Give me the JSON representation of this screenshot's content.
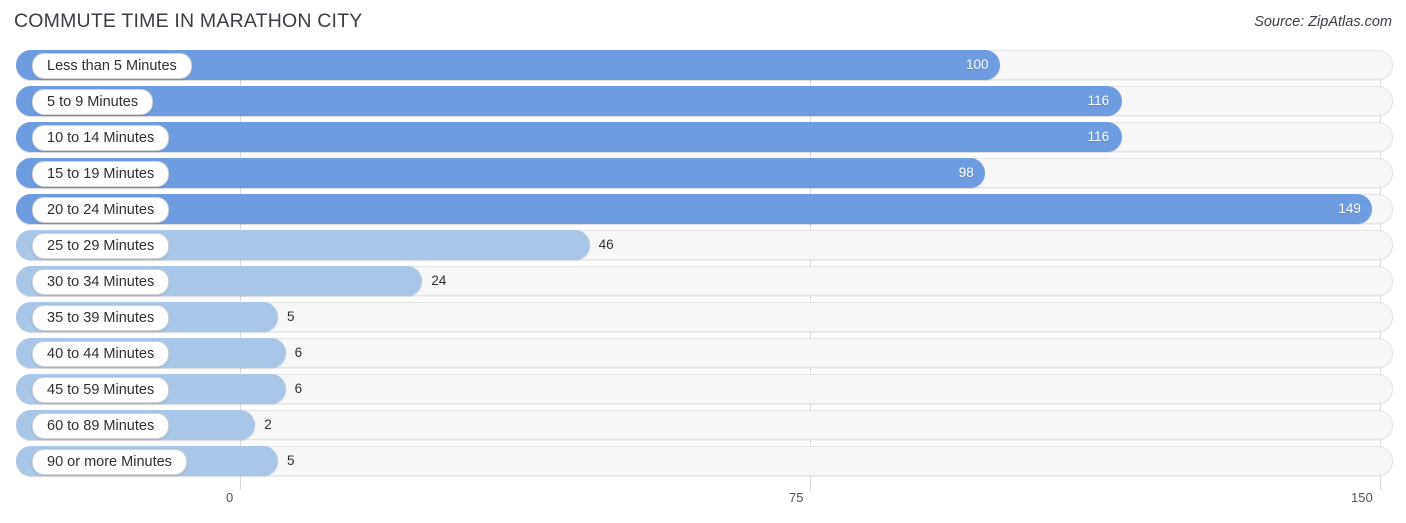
{
  "header": {
    "title": "COMMUTE TIME IN MARATHON CITY",
    "source": "Source: ZipAtlas.com"
  },
  "colors": {
    "bar_strong": "#6d9de0",
    "bar_light": "#a8c6e8",
    "track": "#f7f7f7",
    "track_border": "#e3e3e6",
    "grid": "#d9d9dd",
    "text": "#2f2f35"
  },
  "axis": {
    "ticks": [
      "0",
      "75",
      "150"
    ],
    "min": 0,
    "max": 150
  },
  "chart_data": {
    "type": "bar",
    "orientation": "horizontal",
    "title": "COMMUTE TIME IN MARATHON CITY",
    "source": "Source: ZipAtlas.com",
    "xlabel": "",
    "ylabel": "",
    "xlim": [
      0,
      150
    ],
    "xticks": [
      0,
      75,
      150
    ],
    "grid": true,
    "legend": "none",
    "categories": [
      "Less than 5 Minutes",
      "5 to 9 Minutes",
      "10 to 14 Minutes",
      "15 to 19 Minutes",
      "20 to 24 Minutes",
      "25 to 29 Minutes",
      "30 to 34 Minutes",
      "35 to 39 Minutes",
      "40 to 44 Minutes",
      "45 to 59 Minutes",
      "60 to 89 Minutes",
      "90 or more Minutes"
    ],
    "values": [
      100,
      116,
      116,
      98,
      149,
      46,
      24,
      5,
      6,
      6,
      2,
      5
    ]
  },
  "rows": [
    {
      "label": "Less than 5 Minutes",
      "value": "100",
      "num": 100,
      "inside": true
    },
    {
      "label": "5 to 9 Minutes",
      "value": "116",
      "num": 116,
      "inside": true
    },
    {
      "label": "10 to 14 Minutes",
      "value": "116",
      "num": 116,
      "inside": true
    },
    {
      "label": "15 to 19 Minutes",
      "value": "98",
      "num": 98,
      "inside": true
    },
    {
      "label": "20 to 24 Minutes",
      "value": "149",
      "num": 149,
      "inside": true
    },
    {
      "label": "25 to 29 Minutes",
      "value": "46",
      "num": 46,
      "inside": false
    },
    {
      "label": "30 to 34 Minutes",
      "value": "24",
      "num": 24,
      "inside": false
    },
    {
      "label": "35 to 39 Minutes",
      "value": "5",
      "num": 5,
      "inside": false
    },
    {
      "label": "40 to 44 Minutes",
      "value": "6",
      "num": 6,
      "inside": false
    },
    {
      "label": "45 to 59 Minutes",
      "value": "6",
      "num": 6,
      "inside": false
    },
    {
      "label": "60 to 89 Minutes",
      "value": "2",
      "num": 2,
      "inside": false
    },
    {
      "label": "90 or more Minutes",
      "value": "5",
      "num": 5,
      "inside": false
    }
  ]
}
